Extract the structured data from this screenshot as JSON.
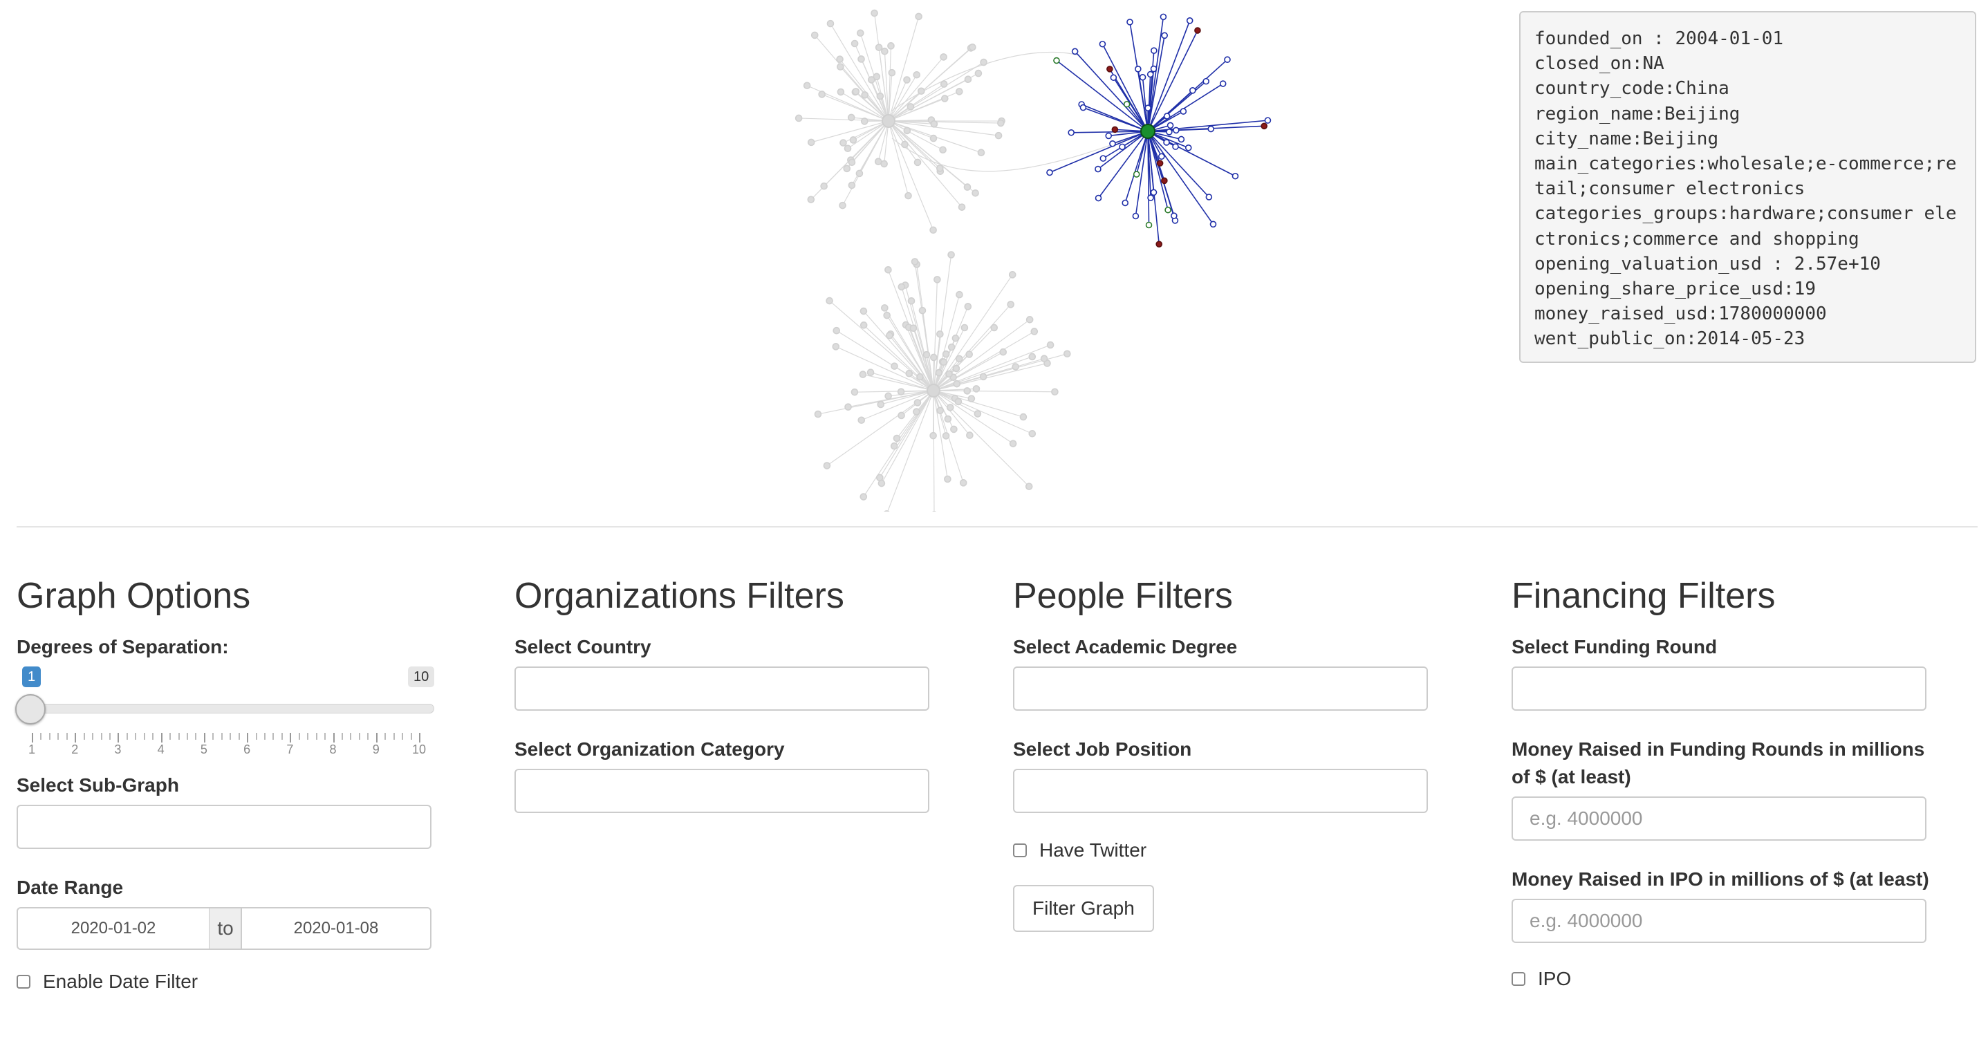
{
  "info": {
    "text": "founded_on : 2004-01-01\nclosed_on:NA\ncountry_code:China\nregion_name:Beijing\ncity_name:Beijing\nmain_categories:wholesale;e-commerce;retail;consumer electronics\ncategories_groups:hardware;consumer electronics;commerce and shopping\nopening_valuation_usd : 2.57e+10\nopening_share_price_usd:19\nmoney_raised_usd:1780000000\nwent_public_on:2014-05-23"
  },
  "graph_options": {
    "title": "Graph Options",
    "degrees_label": "Degrees of Separation:",
    "slider": {
      "min": 1,
      "max": 10,
      "value": 1,
      "min_label": "1",
      "max_label": "10",
      "ticks": [
        "1",
        "2",
        "3",
        "4",
        "5",
        "6",
        "7",
        "8",
        "9",
        "10"
      ]
    },
    "subgraph_label": "Select Sub-Graph",
    "subgraph_value": "",
    "date_range_label": "Date Range",
    "date_start": "2020-01-02",
    "date_sep": "to",
    "date_end": "2020-01-08",
    "date_filter_label": "Enable Date Filter"
  },
  "org_filters": {
    "title": "Organizations Filters",
    "country_label": "Select Country",
    "category_label": "Select Organization Category"
  },
  "people_filters": {
    "title": "People Filters",
    "degree_label": "Select Academic Degree",
    "job_label": "Select Job Position",
    "twitter_label": "Have Twitter",
    "filter_button": "Filter Graph"
  },
  "financing_filters": {
    "title": "Financing Filters",
    "round_label": "Select Funding Round",
    "money_rounds_label": "Money Raised in Funding Rounds in millions of $ (at least)",
    "money_rounds_placeholder": "e.g. 4000000",
    "money_ipo_label": "Money Raised in IPO in millions of $ (at least)",
    "money_ipo_placeholder": "e.g. 4000000",
    "ipo_label": "IPO"
  },
  "colors": {
    "accent": "#337ab7",
    "edge_active": "#1f2fa8",
    "edge_inactive": "#d9d9d9",
    "hub": "#1a8f2e"
  }
}
